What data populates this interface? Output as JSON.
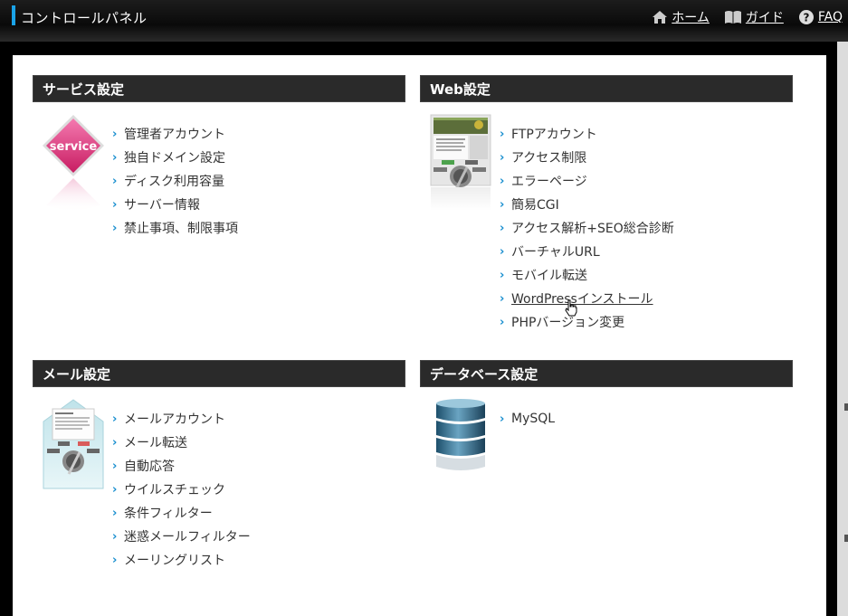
{
  "header": {
    "title": "コントロールパネル",
    "nav": [
      {
        "label": "ホーム",
        "icon": "home-icon"
      },
      {
        "label": "ガイド",
        "icon": "book-icon"
      },
      {
        "label": "FAQ",
        "icon": "help-icon"
      }
    ]
  },
  "colors": {
    "accent": "#1aa3e8",
    "chevron": "#1a8fcf",
    "header_bg": "#2a2a2a"
  },
  "sections": {
    "service": {
      "title": "サービス設定",
      "thumb_text": "service",
      "items": [
        "管理者アカウント",
        "独自ドメイン設定",
        "ディスク利用容量",
        "サーバー情報",
        "禁止事項、制限事項"
      ]
    },
    "web": {
      "title": "Web設定",
      "items": [
        "FTPアカウント",
        "アクセス制限",
        "エラーページ",
        "簡易CGI",
        "アクセス解析+SEO総合診断",
        "バーチャルURL",
        "モバイル転送",
        "WordPressインストール",
        "PHPバージョン変更"
      ]
    },
    "mail": {
      "title": "メール設定",
      "items": [
        "メールアカウント",
        "メール転送",
        "自動応答",
        "ウイルスチェック",
        "条件フィルター",
        "迷惑メールフィルター",
        "メーリングリスト"
      ]
    },
    "db": {
      "title": "データベース設定",
      "items": [
        "MySQL"
      ]
    }
  }
}
